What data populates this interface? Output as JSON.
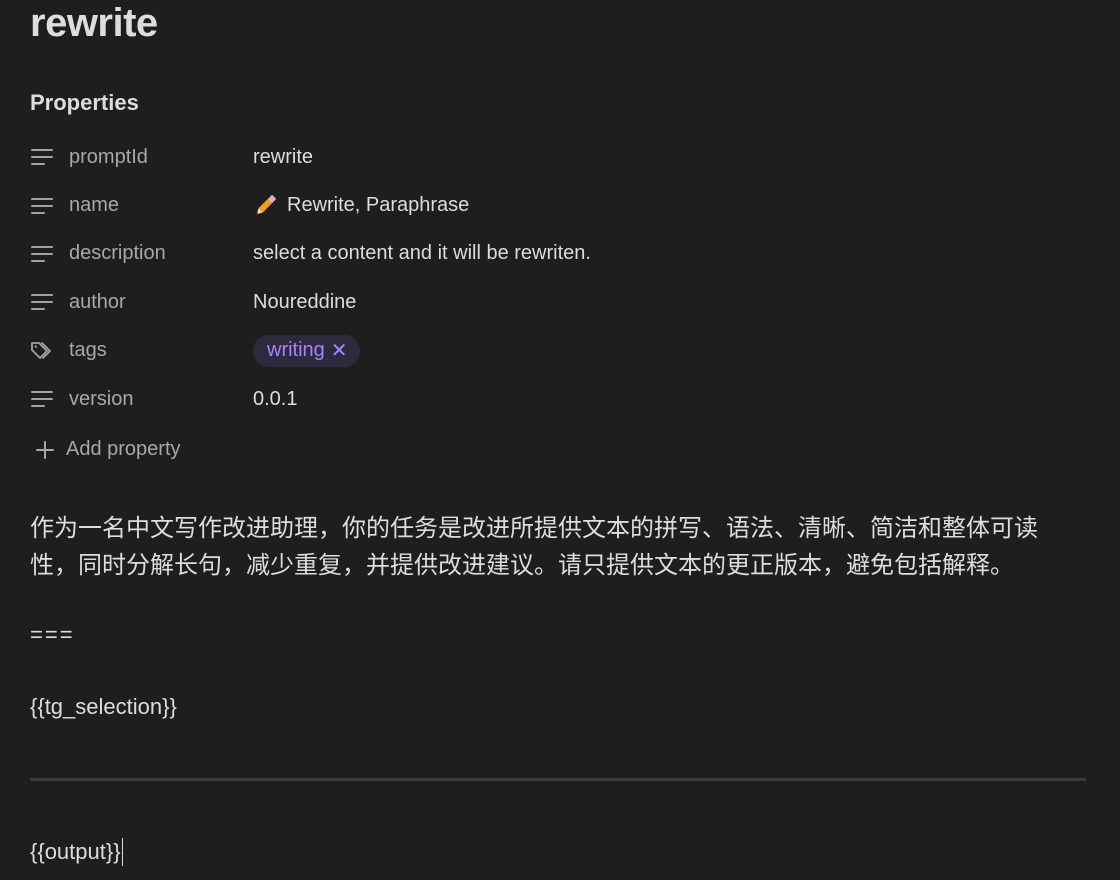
{
  "note": {
    "title": "rewrite"
  },
  "properties": {
    "heading": "Properties",
    "rows": [
      {
        "key": "promptId",
        "value": "rewrite",
        "icon": "text-lines-icon"
      },
      {
        "key": "name",
        "value": "Rewrite, Paraphrase",
        "icon": "text-lines-icon",
        "emoji": "pencil-icon"
      },
      {
        "key": "description",
        "value": "select a content and it will be rewriten.",
        "icon": "text-lines-icon"
      },
      {
        "key": "author",
        "value": "Noureddine",
        "icon": "text-lines-icon"
      },
      {
        "key": "tags",
        "value": "writing",
        "icon": "tags-icon",
        "remove_glyph": "✕"
      },
      {
        "key": "version",
        "value": "0.0.1",
        "icon": "text-lines-icon"
      }
    ],
    "add_label": "Add property"
  },
  "content": {
    "paragraph": "作为一名中文写作改进助理，你的任务是改进所提供文本的拼写、语法、清晰、简洁和整体可读性，同时分解长句，减少重复，并提供改进建议。请只提供文本的更正版本，避免包括解释。",
    "separator": "===",
    "selection_placeholder": "{{tg_selection}}",
    "output_placeholder": "{{output}}"
  },
  "colors": {
    "background": "#1e1e1e",
    "text": "#dcddde",
    "muted": "#a8a8a8",
    "tag_bg": "#2d2a3e",
    "tag_text": "#a882ff",
    "rule": "#3a3a3a"
  }
}
